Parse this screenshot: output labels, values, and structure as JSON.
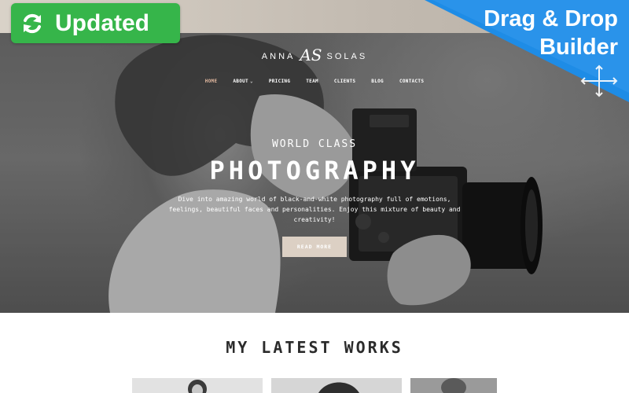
{
  "brand": {
    "first": "ANNA",
    "monogram": "AS",
    "last": "SOLAS"
  },
  "nav": {
    "items": [
      {
        "label": "HOME",
        "active": true
      },
      {
        "label": "ABOUT",
        "has_dropdown": true
      },
      {
        "label": "PRICING"
      },
      {
        "label": "TEAM"
      },
      {
        "label": "CLIENTS"
      },
      {
        "label": "BLOG"
      },
      {
        "label": "CONTACTS"
      }
    ]
  },
  "hero": {
    "eyebrow": "WORLD CLASS",
    "headline": "PHOTOGRAPHY",
    "description": "Dive into amazing world of black-and-white photography full of emotions, feelings, beautiful faces and personalities. Enjoy this mixture of beauty and creativity!",
    "cta_label": "READ MORE"
  },
  "badges": {
    "updated": "Updated",
    "updated_icon": "refresh-icon",
    "dnd_line1": "Drag & Drop",
    "dnd_line2": "Builder",
    "dnd_icon": "move-arrows-icon"
  },
  "works": {
    "title": "MY LATEST WORKS"
  },
  "colors": {
    "updated_green": "#36b54a",
    "dnd_blue": "#1e8ce6",
    "nav_active": "#e3b9a0",
    "cta_bg": "#dcd0c4"
  }
}
